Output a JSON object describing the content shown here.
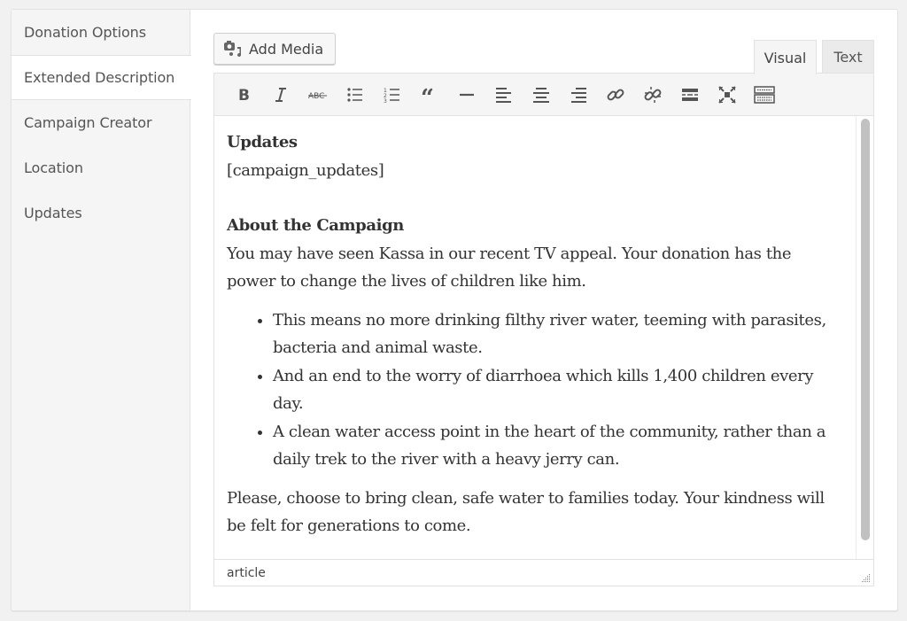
{
  "sidebar": {
    "items": [
      {
        "label": "Donation Options",
        "active": false
      },
      {
        "label": "Extended Description",
        "active": true
      },
      {
        "label": "Campaign Creator",
        "active": false
      },
      {
        "label": "Location",
        "active": false
      },
      {
        "label": "Updates",
        "active": false
      }
    ]
  },
  "media": {
    "add_media_label": "Add Media",
    "icon": "add-media-icon"
  },
  "editor_tabs": {
    "visual": "Visual",
    "text": "Text",
    "active": "Visual"
  },
  "toolbar": {
    "buttons": [
      {
        "name": "bold",
        "icon": "bold-icon"
      },
      {
        "name": "italic",
        "icon": "italic-icon"
      },
      {
        "name": "strikethrough",
        "icon": "strikethrough-icon"
      },
      {
        "name": "bulleted-list",
        "icon": "bulleted-list-icon"
      },
      {
        "name": "numbered-list",
        "icon": "numbered-list-icon"
      },
      {
        "name": "blockquote",
        "icon": "blockquote-icon"
      },
      {
        "name": "horizontal-line",
        "icon": "horizontal-line-icon"
      },
      {
        "name": "align-left",
        "icon": "align-left-icon"
      },
      {
        "name": "align-center",
        "icon": "align-center-icon"
      },
      {
        "name": "align-right",
        "icon": "align-right-icon"
      },
      {
        "name": "insert-link",
        "icon": "link-icon"
      },
      {
        "name": "remove-link",
        "icon": "unlink-icon"
      },
      {
        "name": "read-more",
        "icon": "read-more-icon"
      },
      {
        "name": "fullscreen",
        "icon": "fullscreen-icon"
      },
      {
        "name": "toolbar-toggle",
        "icon": "keyboard-icon"
      }
    ]
  },
  "content": {
    "updates_heading": "Updates",
    "updates_shortcode": "[campaign_updates]",
    "about_heading": "About the Campaign",
    "intro": "You may have seen Kassa in our recent TV appeal. Your donation has the power to change the lives of children like him.",
    "bullets": [
      "This means no more drinking filthy river water, teeming with parasites, bacteria and animal waste.",
      "And an end to the worry of diarrhoea which kills 1,400 children every day.",
      "A clean water access point in the heart of the community, rather than a daily trek to the river with a heavy jerry can."
    ],
    "closing": "Please, choose to bring clean, safe water to families today. Your kindness will be felt for generations to come."
  },
  "statusbar": {
    "path": "article"
  }
}
